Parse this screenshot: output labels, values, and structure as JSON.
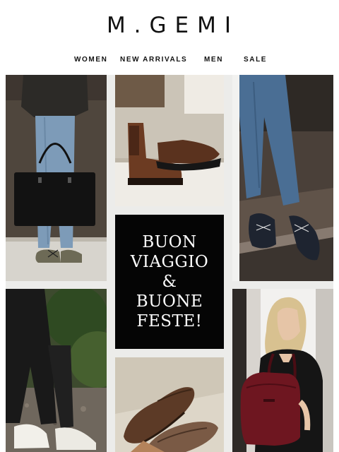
{
  "brand": {
    "logo_text": "M.GEMI"
  },
  "nav": {
    "items": [
      {
        "label": "WOMEN"
      },
      {
        "label": "NEW ARRIVALS"
      },
      {
        "label": "MEN"
      },
      {
        "label": "SALE"
      }
    ]
  },
  "promo": {
    "lines": [
      "BUON",
      "VIAGGIO",
      "&",
      "BUONE",
      "FESTE!"
    ]
  },
  "colors": {
    "background": "#ffffff",
    "promo_bg": "#050505",
    "promo_text": "#ffffff",
    "grid_gap": "#ececea"
  },
  "images": [
    {
      "name": "woman-black-tote-ballet-flats-photo",
      "icon": "photo"
    },
    {
      "name": "brown-chelsea-boots-photo",
      "icon": "photo"
    },
    {
      "name": "navy-ballet-flats-jeans-photo",
      "icon": "photo"
    },
    {
      "name": "white-sneakers-black-pants-photo",
      "icon": "photo"
    },
    {
      "name": "brown-driving-loafers-photo",
      "icon": "photo"
    },
    {
      "name": "woman-burgundy-leather-backpack-photo",
      "icon": "photo"
    }
  ]
}
